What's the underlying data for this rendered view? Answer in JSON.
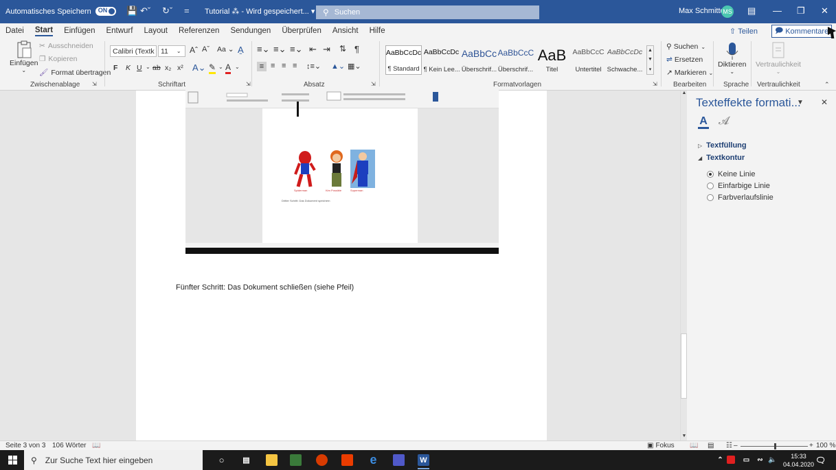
{
  "titlebar": {
    "autosave_label": "Automatisches Speichern",
    "autosave_state": "ON",
    "doc_title": "Tutorial ⁂ - Wird gespeichert... ▾",
    "search_placeholder": "Suchen",
    "user_name": "Max Schmitte",
    "user_initials": "MS",
    "colors": {
      "bar": "#2b579a",
      "avatar": "#4bc8b0"
    }
  },
  "tabs": [
    "Datei",
    "Start",
    "Einfügen",
    "Entwurf",
    "Layout",
    "Referenzen",
    "Sendungen",
    "Überprüfen",
    "Ansicht",
    "Hilfe"
  ],
  "active_tab": "Start",
  "share_label": "Teilen",
  "comments_label": "Kommentare",
  "ribbon": {
    "clipboard": {
      "paste": "Einfügen",
      "cut": "Ausschneiden",
      "copy": "Kopieren",
      "format_painter": "Format übertragen",
      "label": "Zwischenablage"
    },
    "font": {
      "name": "Calibri (Textk",
      "size": "11",
      "label": "Schriftart",
      "bold": "F",
      "italic": "K",
      "underline": "U"
    },
    "paragraph": {
      "label": "Absatz"
    },
    "styles": {
      "label": "Formatvorlagen",
      "items": [
        {
          "preview": "AaBbCcDc",
          "name": "¶ Standard"
        },
        {
          "preview": "AaBbCcDc",
          "name": "¶ Kein Lee..."
        },
        {
          "preview": "AaBbCc",
          "name": "Überschrif..."
        },
        {
          "preview": "AaBbCcC",
          "name": "Überschrif..."
        },
        {
          "preview": "AaB",
          "name": "Titel"
        },
        {
          "preview": "AaBbCcC",
          "name": "Untertitel"
        },
        {
          "preview": "AaBbCcDc",
          "name": "Schwache..."
        }
      ]
    },
    "editing": {
      "label": "Bearbeiten",
      "search": "Suchen",
      "replace": "Ersetzen",
      "select": "Markieren"
    },
    "voice": {
      "label": "Sprache",
      "dictate": "Diktieren"
    },
    "sensitivity": {
      "label": "Vertraulichkeit",
      "button": "Vertraulichkeit"
    }
  },
  "document": {
    "step5_text": "Fünfter Schritt: Das Dokument schließen (siehe Pfeil)",
    "embedded_captions": [
      "Spiderman",
      "Kim Possible",
      "Superman"
    ],
    "embedded_line": "Dritter Schritt: Das Dokument speichern"
  },
  "pane": {
    "title": "Texteffekte formati...",
    "sections": {
      "fill": "Textfüllung",
      "outline": "Textkontur"
    },
    "options": [
      {
        "label": "Keine Linie",
        "selected": true
      },
      {
        "label": "Einfarbige Linie",
        "selected": false
      },
      {
        "label": "Farbverlaufslinie",
        "selected": false
      }
    ]
  },
  "statusbar": {
    "page": "Seite 3 von 3",
    "words": "106 Wörter",
    "focus": "Fokus",
    "zoom": "100 %",
    "zoom_percent": 100
  },
  "taskbar": {
    "search_placeholder": "Zur Suche Text hier eingeben",
    "time": "15:33",
    "date": "04.04.2020"
  }
}
